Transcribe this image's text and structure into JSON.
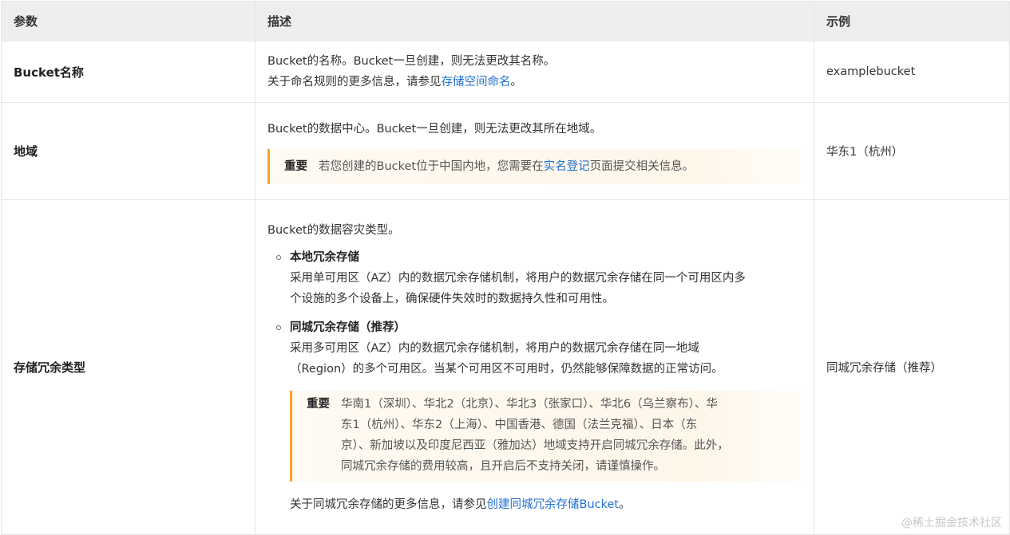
{
  "headers": {
    "param": "参数",
    "desc": "描述",
    "example": "示例"
  },
  "rows": {
    "bucket": {
      "name": "Bucket名称",
      "desc_line1": "Bucket的名称。Bucket一旦创建，则无法更改其名称。",
      "desc_line2_prefix": "关于命名规则的更多信息，请参见",
      "desc_line2_link": "存储空间命名",
      "desc_line2_suffix": "。",
      "example": "examplebucket"
    },
    "region": {
      "name": "地域",
      "desc_line1": "Bucket的数据中心。Bucket一旦创建，则无法更改其所在地域。",
      "note_label": "重要",
      "note_prefix": "若您创建的Bucket位于中国内地，您需要在",
      "note_link": "实名登记",
      "note_suffix": "页面提交相关信息。",
      "example": "华东1（杭州）"
    },
    "redundancy": {
      "name": "存储冗余类型",
      "desc_line1": "Bucket的数据容灾类型。",
      "opt1_title": "本地冗余存储",
      "opt1_line1": "采用单可用区（AZ）内的数据冗余存储机制，将用户的数据冗余存储在同一个可用区内多",
      "opt1_line2": "个设施的多个设备上，确保硬件失效时的数据持久性和可用性。",
      "opt2_title": "同城冗余存储（推荐）",
      "opt2_line1": "采用多可用区（AZ）内的数据冗余存储机制，将用户的数据冗余存储在同一地域",
      "opt2_line2": "（Region）的多个可用区。当某个可用区不可用时，仍然能够保障数据的正常访问。",
      "note_label": "重要",
      "note_line1": "华南1（深圳）、华北2（北京）、华北3（张家口）、华北6（乌兰察布）、华",
      "note_line2": "东1（杭州）、华东2（上海）、中国香港、德国（法兰克福）、日本（东",
      "note_line3": "京）、新加坡以及印度尼西亚（雅加达）地域支持开启同城冗余存储。此外，",
      "note_line4": "同城冗余存储的费用较高，且开启后不支持关闭，请谨慎操作。",
      "more_prefix": "关于同城冗余存储的更多信息，请参见",
      "more_link": "创建同城冗余存储Bucket",
      "more_suffix": "。",
      "example": "同城冗余存储（推荐）"
    }
  },
  "watermark": "@稀土掘金技术社区",
  "colors": {
    "link": "#1f6fd3",
    "note_border": "#f5a623",
    "header_bg": "#eeeeee"
  }
}
